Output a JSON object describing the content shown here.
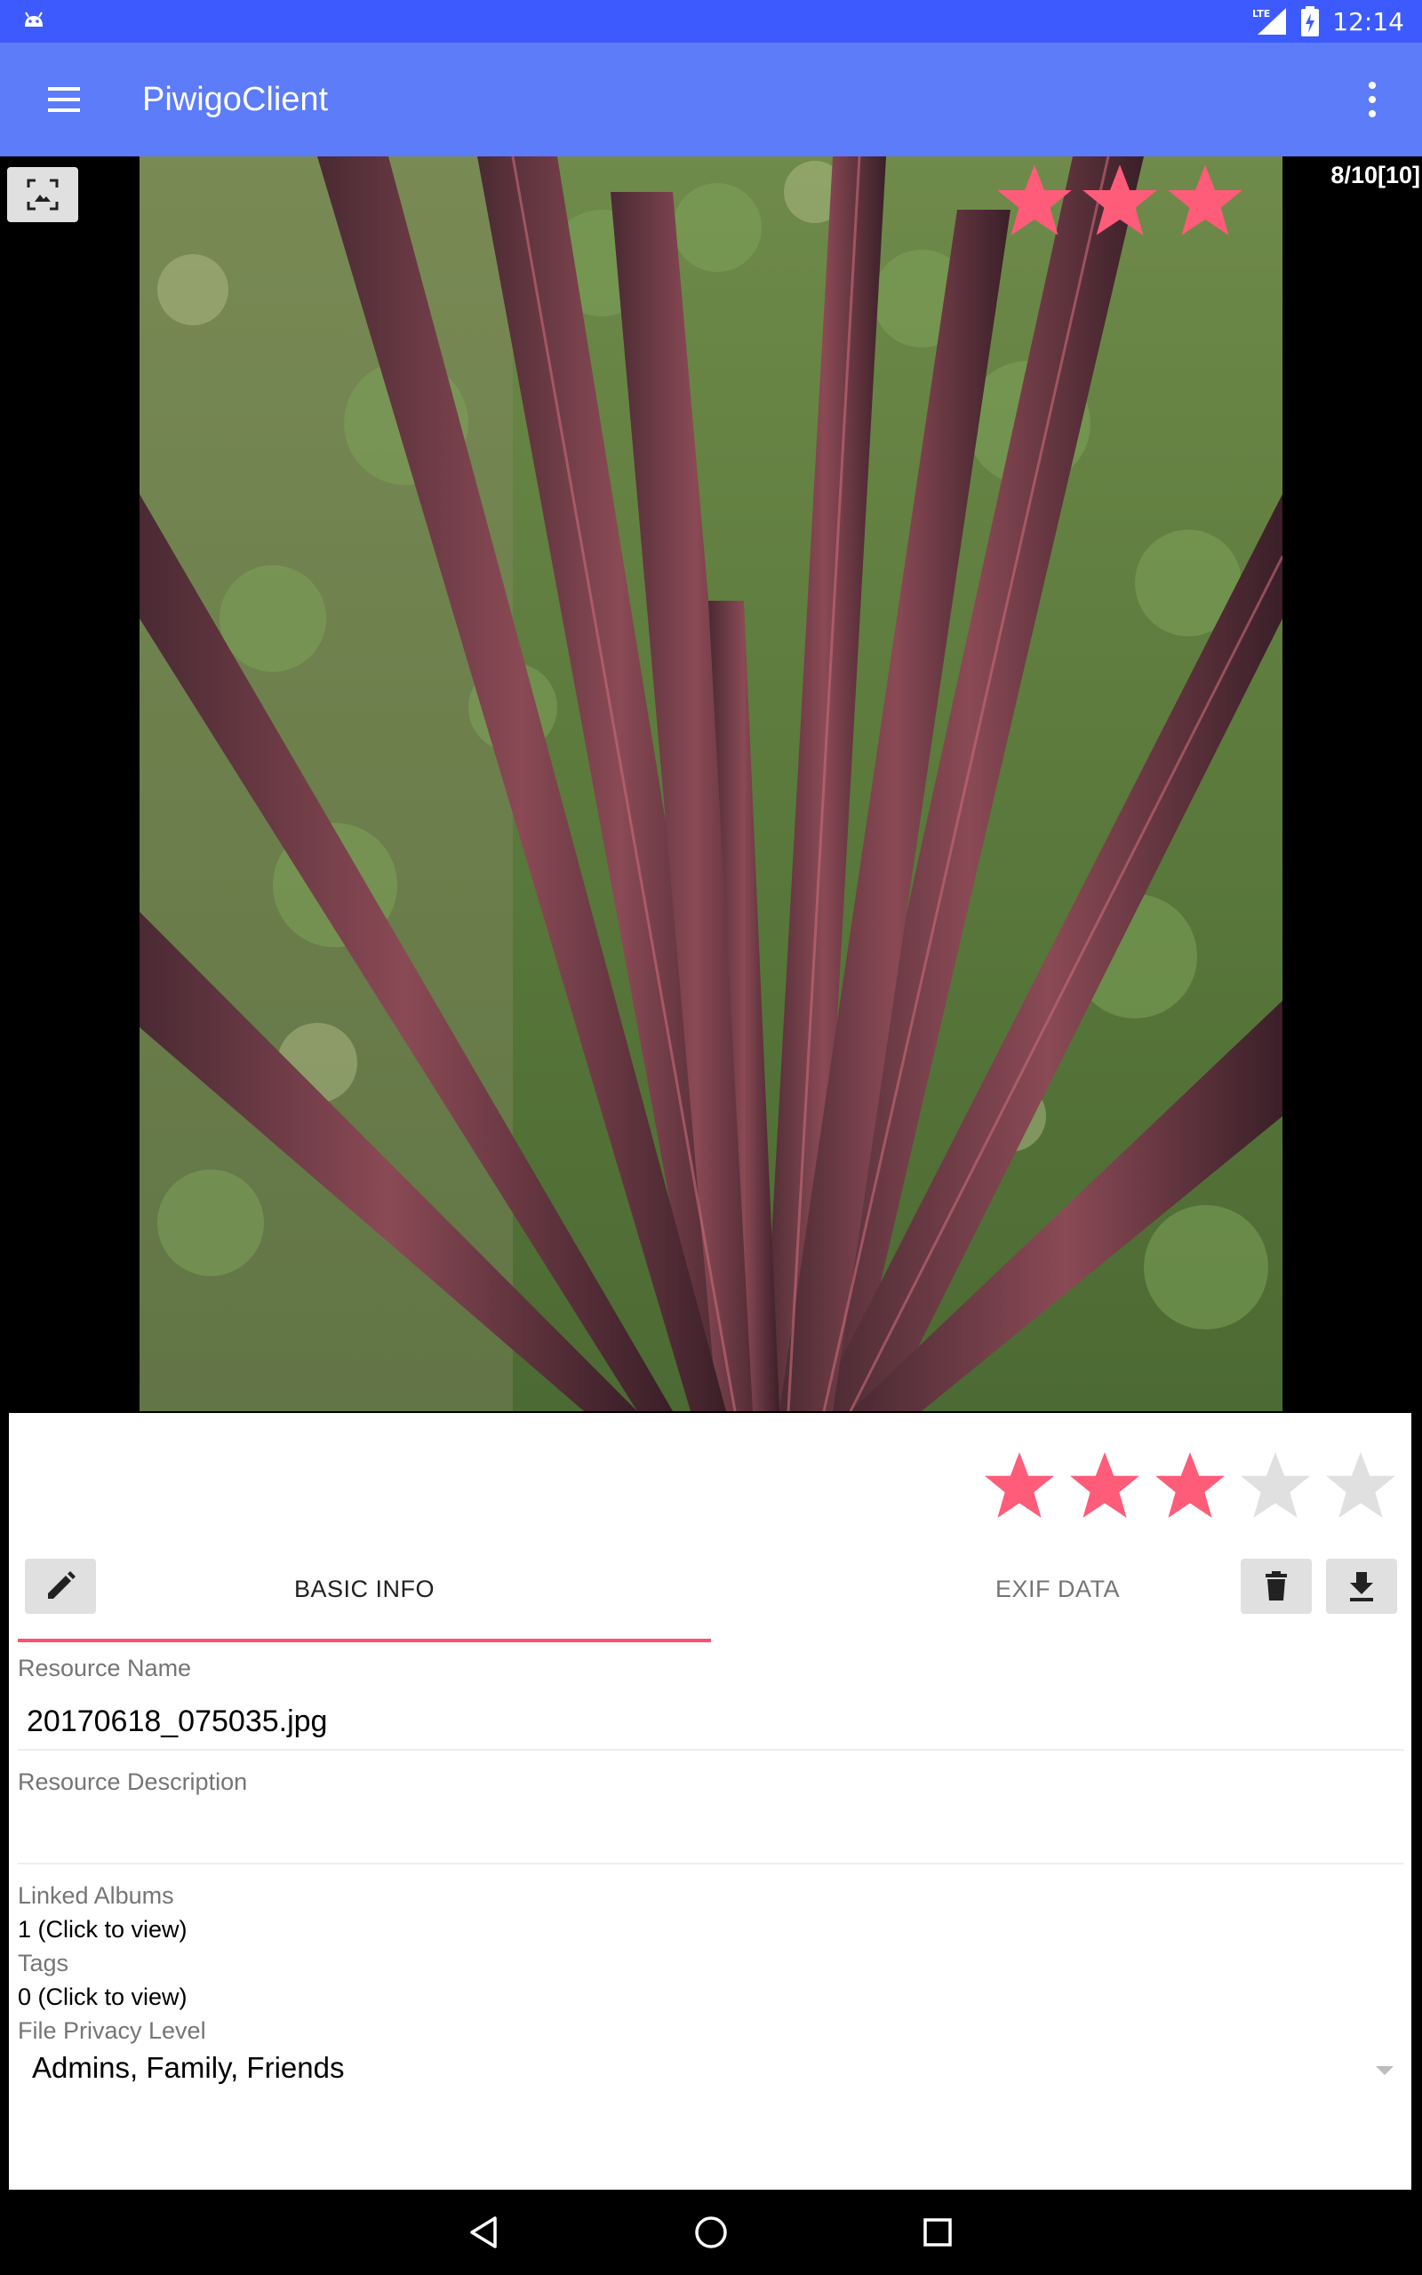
{
  "status_bar": {
    "time": "12:14",
    "network": "LTE",
    "icons": [
      "android-icon",
      "lte-signal-icon",
      "battery-charging-icon"
    ]
  },
  "app_bar": {
    "title": "PiwigoClient",
    "icons": [
      "menu-icon",
      "more-vert-icon"
    ]
  },
  "viewer": {
    "counter": "8/10[10]",
    "overlay_rating": 3,
    "icons": [
      "fullscreen-icon"
    ],
    "photo_description": "Purple cordyline plant leaves against green foliage"
  },
  "details": {
    "rating": {
      "value": 3,
      "max": 5
    },
    "buttons": {
      "edit_icon": "pencil-icon",
      "delete_icon": "trash-icon",
      "download_icon": "download-icon"
    },
    "tabs": [
      {
        "label": "BASIC INFO",
        "active": true
      },
      {
        "label": "EXIF DATA",
        "active": false
      }
    ],
    "resource_name": {
      "label": "Resource Name",
      "value": "20170618_075035.jpg"
    },
    "resource_description": {
      "label": "Resource Description",
      "value": ""
    },
    "linked_albums": {
      "label": "Linked Albums",
      "value": "1 (Click to view)"
    },
    "tags": {
      "label": "Tags",
      "value": "0 (Click to view)"
    },
    "privacy": {
      "label": "File Privacy Level",
      "value": "Admins, Family, Friends"
    }
  },
  "colors": {
    "status_bar": "#3d5afe",
    "app_bar": "#5c7cfa",
    "accent": "#ff5c7a",
    "star_empty": "#e0e0e0"
  },
  "nav_bar": {
    "icons": [
      "back-icon",
      "home-icon",
      "recents-icon"
    ]
  }
}
